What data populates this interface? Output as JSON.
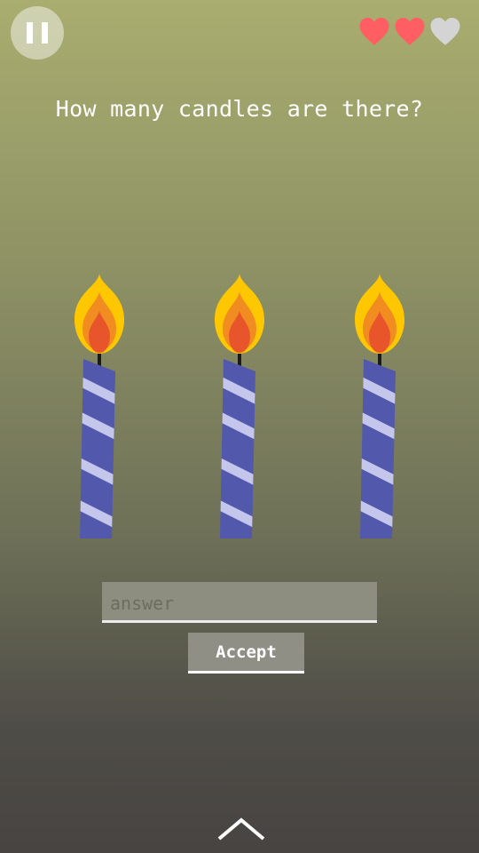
{
  "hud": {
    "pause_icon": "pause-icon",
    "lives": [
      {
        "state": "full",
        "color": "#ff5f63"
      },
      {
        "state": "full",
        "color": "#ff5f63"
      },
      {
        "state": "empty",
        "color": "#d4d4d4"
      }
    ]
  },
  "question": "How many candles are there?",
  "puzzle": {
    "candle_count": 3,
    "colors": {
      "candle_body": "#5258ab",
      "candle_stripe": "#c4c6ec",
      "flame_outer": "#ffc700",
      "flame_mid": "#f08c20",
      "flame_inner": "#e9552b",
      "wick": "#1a1a1a"
    }
  },
  "answer_field": {
    "placeholder": "answer",
    "value": ""
  },
  "accept_button": {
    "label": "Accept"
  },
  "bottom_nav": {
    "icon": "chevron-up-icon"
  }
}
